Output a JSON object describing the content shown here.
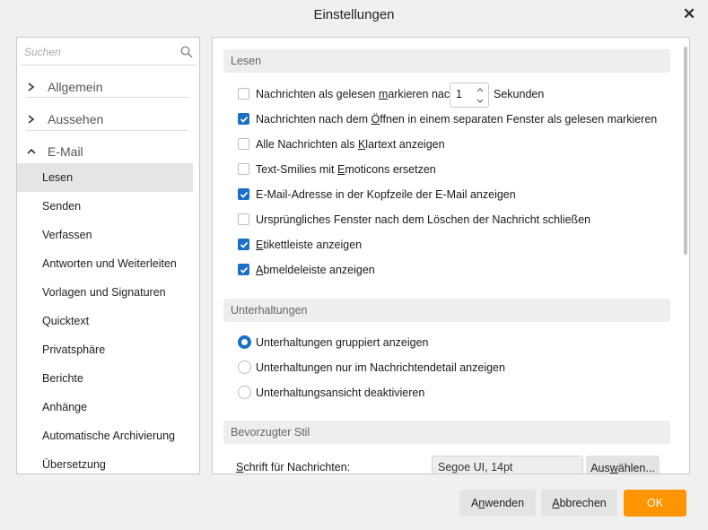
{
  "window": {
    "title": "Einstellungen",
    "close_glyph": "✕"
  },
  "sidebar": {
    "search_placeholder": "Suchen",
    "categories": [
      {
        "label": "Allgemein",
        "expanded": false
      },
      {
        "label": "Aussehen",
        "expanded": false
      },
      {
        "label": "E-Mail",
        "expanded": true
      }
    ],
    "email_items": [
      {
        "label": "Lesen",
        "selected": true
      },
      {
        "label": "Senden",
        "selected": false
      },
      {
        "label": "Verfassen",
        "selected": false
      },
      {
        "label": "Antworten und Weiterleiten",
        "selected": false
      },
      {
        "label": "Vorlagen und Signaturen",
        "selected": false
      },
      {
        "label": "Quicktext",
        "selected": false
      },
      {
        "label": "Privatsphäre",
        "selected": false
      },
      {
        "label": "Berichte",
        "selected": false
      },
      {
        "label": "Anhänge",
        "selected": false
      },
      {
        "label": "Automatische Archivierung",
        "selected": false
      },
      {
        "label": "Übersetzung",
        "selected": false
      }
    ]
  },
  "sections": {
    "lesen": {
      "title": "Lesen",
      "options": [
        {
          "pre": "Nachrichten als gelesen ",
          "u": "m",
          "post": "arkieren nach",
          "checked": false,
          "spinner_value": "1",
          "suffix": "Sekunden"
        },
        {
          "pre": "Nachrichten nach dem ",
          "u": "Ö",
          "post": "ffnen in einem separaten Fenster als gelesen markieren",
          "checked": true
        },
        {
          "pre": "Alle Nachrichten als ",
          "u": "K",
          "post": "lartext anzeigen",
          "checked": false
        },
        {
          "pre": "Text-Smilies mit ",
          "u": "E",
          "post": "moticons ersetzen",
          "checked": false
        },
        {
          "pre": "E-Mail-Adresse in der Kopfzeile der E-Mail anzeigen",
          "u": "",
          "post": "",
          "checked": true
        },
        {
          "pre": "Ursprüngliches Fenster nach dem Löschen der Nachricht schließen",
          "u": "",
          "post": "",
          "checked": false
        },
        {
          "pre": "",
          "u": "E",
          "post": "tikettleiste anzeigen",
          "checked": true
        },
        {
          "pre": "",
          "u": "A",
          "post": "bmeldeleiste anzeigen",
          "checked": true
        }
      ]
    },
    "unterhaltungen": {
      "title": "Unterhaltungen",
      "options": [
        {
          "label": "Unterhaltungen gruppiert anzeigen",
          "selected": true
        },
        {
          "label": "Unterhaltungen nur im Nachrichtendetail anzeigen",
          "selected": false
        },
        {
          "label": "Unterhaltungsansicht deaktivieren",
          "selected": false
        }
      ]
    },
    "stil": {
      "title": "Bevorzugter Stil",
      "font_label_u": "S",
      "font_label_rest": "chrift für Nachrichten:",
      "font_value": "Segoe UI, 14pt",
      "choose_pre": "Aus",
      "choose_u": "w",
      "choose_post": "ählen..."
    }
  },
  "footer": {
    "apply_pre": "A",
    "apply_u": "n",
    "apply_post": "wenden",
    "cancel_pre": "",
    "cancel_u": "A",
    "cancel_post": "bbrechen",
    "ok_label": "OK"
  },
  "colors": {
    "accent": "#1a6fc9",
    "ok_button": "#ff9500"
  }
}
